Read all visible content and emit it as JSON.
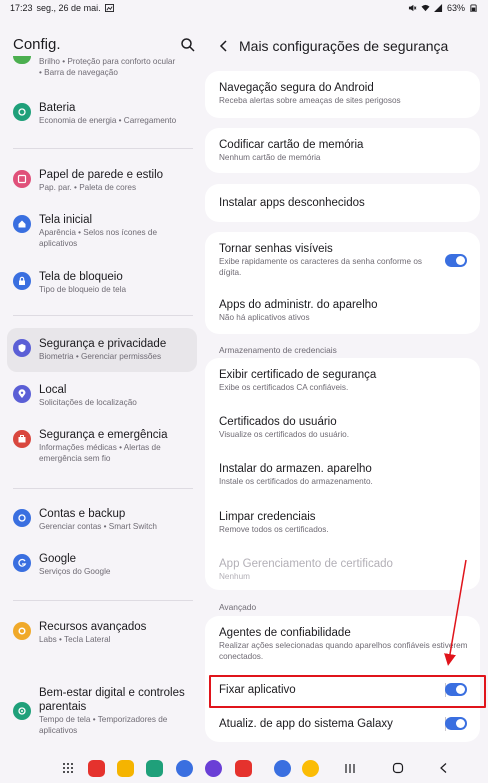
{
  "statusbar": {
    "time": "17:23",
    "date": "seg., 26 de mai.",
    "battery": "63%"
  },
  "left": {
    "title": "Config.",
    "items": [
      {
        "label": "",
        "sub": "Brilho • Proteção para conforto ocular\n• Barra de navegação",
        "icon_color": "#4caf50",
        "icon": "brightness-icon"
      },
      {
        "label": "Bateria",
        "sub": "Economia de energia • Carregamento",
        "icon_color": "#1fa07a",
        "icon": "battery-icon"
      },
      {
        "label": "Papel de parede e estilo",
        "sub": "Pap. par. • Paleta de cores",
        "icon_color": "#e0507a",
        "icon": "wallpaper-icon"
      },
      {
        "label": "Tela inicial",
        "sub": "Aparência • Selos nos ícones de aplicativos",
        "icon_color": "#3a6fe0",
        "icon": "home-icon"
      },
      {
        "label": "Tela de bloqueio",
        "sub": "Tipo de bloqueio de tela",
        "icon_color": "#3a6fe0",
        "icon": "lock-icon"
      },
      {
        "label": "Segurança e privacidade",
        "sub": "Biometria • Gerenciar permissões",
        "icon_color": "#5b5fd6",
        "icon": "shield-icon"
      },
      {
        "label": "Local",
        "sub": "Solicitações de localização",
        "icon_color": "#5b5fd6",
        "icon": "location-icon"
      },
      {
        "label": "Segurança e emergência",
        "sub": "Informações médicas • Alertas de emergência sem fio",
        "icon_color": "#d9473f",
        "icon": "emergency-icon"
      },
      {
        "label": "Contas e backup",
        "sub": "Gerenciar contas • Smart Switch",
        "icon_color": "#3a6fe0",
        "icon": "sync-icon"
      },
      {
        "label": "Google",
        "sub": "Serviços do Google",
        "icon_color": "#3a6fe0",
        "icon": "google-icon"
      },
      {
        "label": "Recursos avançados",
        "sub": "Labs • Tecla Lateral",
        "icon_color": "#f0a92a",
        "icon": "gear-plus-icon"
      },
      {
        "label": "Bem-estar digital e controles parentais",
        "sub": "Tempo de tela • Temporizadores de aplicativos",
        "icon_color": "#1fa07a",
        "icon": "wellbeing-icon"
      }
    ]
  },
  "right": {
    "title": "Mais configurações de segurança",
    "rows": [
      {
        "title": "Navegação segura do Android",
        "sub": "Receba alertas sobre ameaças de sites perigosos"
      },
      {
        "title": "Codificar cartão de memória",
        "sub": "Nenhum cartão de memória"
      },
      {
        "title": "Instalar apps desconhecidos",
        "sub": ""
      },
      {
        "title": "Tornar senhas visíveis",
        "sub": "Exibe rapidamente os caracteres da senha conforme os dígita."
      },
      {
        "title": "Apps do administr. do aparelho",
        "sub": "Não há aplicativos ativos"
      },
      {
        "title": "Exibir certificado de segurança",
        "sub": "Exibe os certificados CA confiáveis."
      },
      {
        "title": "Certificados do usuário",
        "sub": "Visualize os certificados do usuário."
      },
      {
        "title": "Instalar do armazen. aparelho",
        "sub": "Instale os certificados do armazenamento."
      },
      {
        "title": "Limpar credenciais",
        "sub": "Remove todos os certificados."
      },
      {
        "title": "App Gerenciamento de certificado",
        "sub": "Nenhum"
      },
      {
        "title": "Agentes de confiabilidade",
        "sub": "Realizar ações selecionadas quando aparelhos confiáveis estiverem conectados."
      },
      {
        "title": "Fixar aplicativo",
        "sub": ""
      },
      {
        "title": "Atualiz. de app do sistema Galaxy",
        "sub": ""
      }
    ],
    "section_credentials": "Armazenamento de credenciais",
    "section_advanced": "Avançado",
    "toggles": {
      "senhas": true,
      "fixar": true,
      "galaxy": true
    }
  },
  "colors": {
    "accent": "#3a6fe0",
    "highlight": "#e0141b"
  }
}
